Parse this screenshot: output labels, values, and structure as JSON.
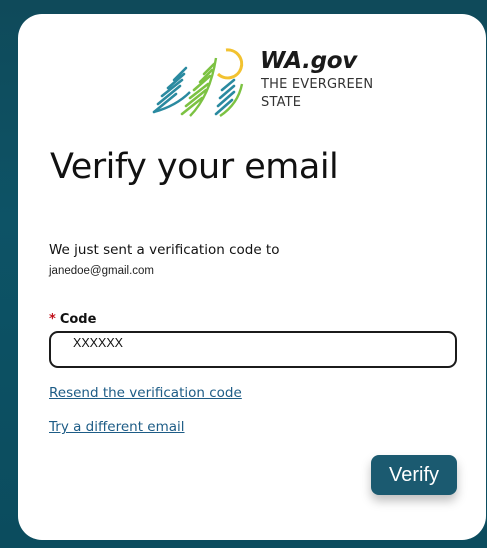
{
  "logo": {
    "title": "WA.gov",
    "subtitle_line1": "THE EVERGREEN",
    "subtitle_line2": "STATE",
    "colors": {
      "tree_green": "#7cc242",
      "tree_teal": "#2a8aa0",
      "sun_yellow": "#f2c230"
    }
  },
  "page": {
    "title": "Verify your email",
    "intro": "We just sent a verification code to",
    "email": "janedoe@gmail.com"
  },
  "form": {
    "code_label": "Code",
    "required_marker": "*",
    "code_value": "XXXXXX"
  },
  "links": {
    "resend": "Resend the verification code",
    "different_email": "Try a different email"
  },
  "actions": {
    "verify_label": "Verify"
  },
  "colors": {
    "background": "#0d5366",
    "card": "#ffffff",
    "button": "#1b5a70",
    "link": "#1d5c86",
    "required": "#c0101a"
  }
}
